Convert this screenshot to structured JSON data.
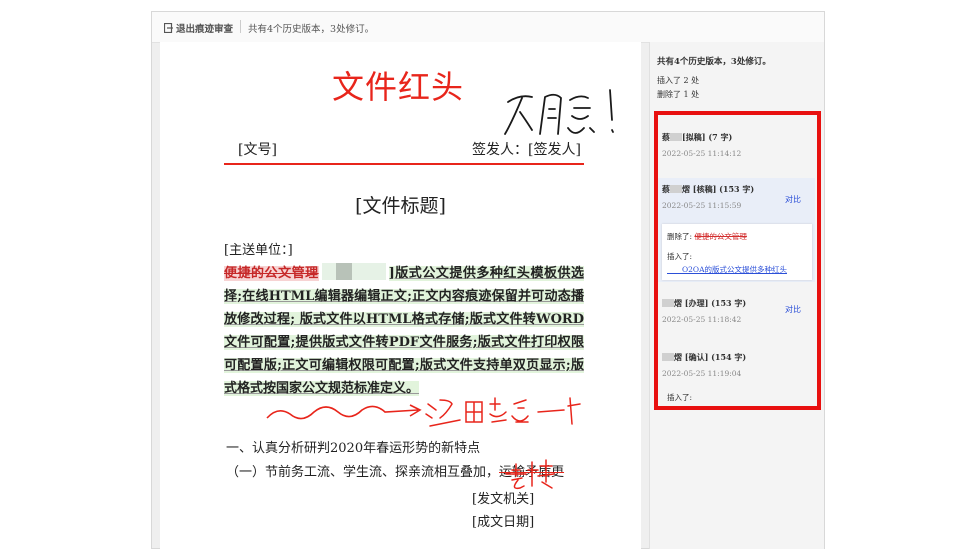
{
  "toolbar": {
    "exit_label": "退出痕迹审查",
    "info": "共有4个历史版本，3处修订。"
  },
  "document": {
    "red_head": "文件红头",
    "handwriting_top": "不同意!",
    "doc_number": "[文号]",
    "signer": "签发人：[签发人]",
    "title": "[文件标题]",
    "recipient": "[主送单位：]",
    "deleted_text": "便捷的公文管理",
    "inserted_text": "]版式公文提供多种红头模板供选择;在线HTML编辑器编辑正文;正文内容痕迹保留并可动态播放修改过程; 版式文件以HTML格式存储;版式文件转WORD文件可配置;提供版式文件转PDF文件服务;版式文件打印权限可配置版;正文可编辑权限可配置;版式文件支持单双页显示;版式格式按国家公文规范标准定义。",
    "handwriting_middle": "这里多空一行",
    "heading_1": "一、认真分析研判2020年春运形势的新特点",
    "heading_2_prefix": "（一）节前务工流、学生流、探亲流相互叠加，",
    "heading_2_struck": "运输矛盾更",
    "handwriting_right": "去掉",
    "issuer": "[发文机关]",
    "date": "[成文日期]"
  },
  "panel": {
    "summary": "共有4个历史版本，3处修订。",
    "inserted_count": "插入了 2 处",
    "deleted_count": "删除了 1 处",
    "entries": [
      {
        "name_prefix": "蔡",
        "name_suffix": "[拟稿] (7 字)",
        "time": "2022-05-25 11:14:12"
      },
      {
        "name_prefix": "蔡",
        "name_suffix": "熠 [核稿] (153 字)",
        "time": "2022-05-25 11:15:59",
        "compare": "对比"
      },
      {
        "name_prefix": "",
        "name_suffix": "熠 [办理] (153 字)",
        "time": "2022-05-25 11:18:42",
        "compare": "对比"
      },
      {
        "name_prefix": "",
        "name_suffix": "熠 [确认] (154 字)",
        "time": "2022-05-25 11:19:04"
      }
    ],
    "detail": {
      "deleted_label": "删除了: ",
      "deleted_value": "便捷的公文管理",
      "inserted_label": "插入了:",
      "inserted_value": "O2OA的版式公文提供多种红头"
    },
    "last_insert_label": "插入了:"
  },
  "colors": {
    "accent_red": "#e8251b",
    "link_blue": "#2b4fd8",
    "insert_green": "#e2f4dc"
  }
}
